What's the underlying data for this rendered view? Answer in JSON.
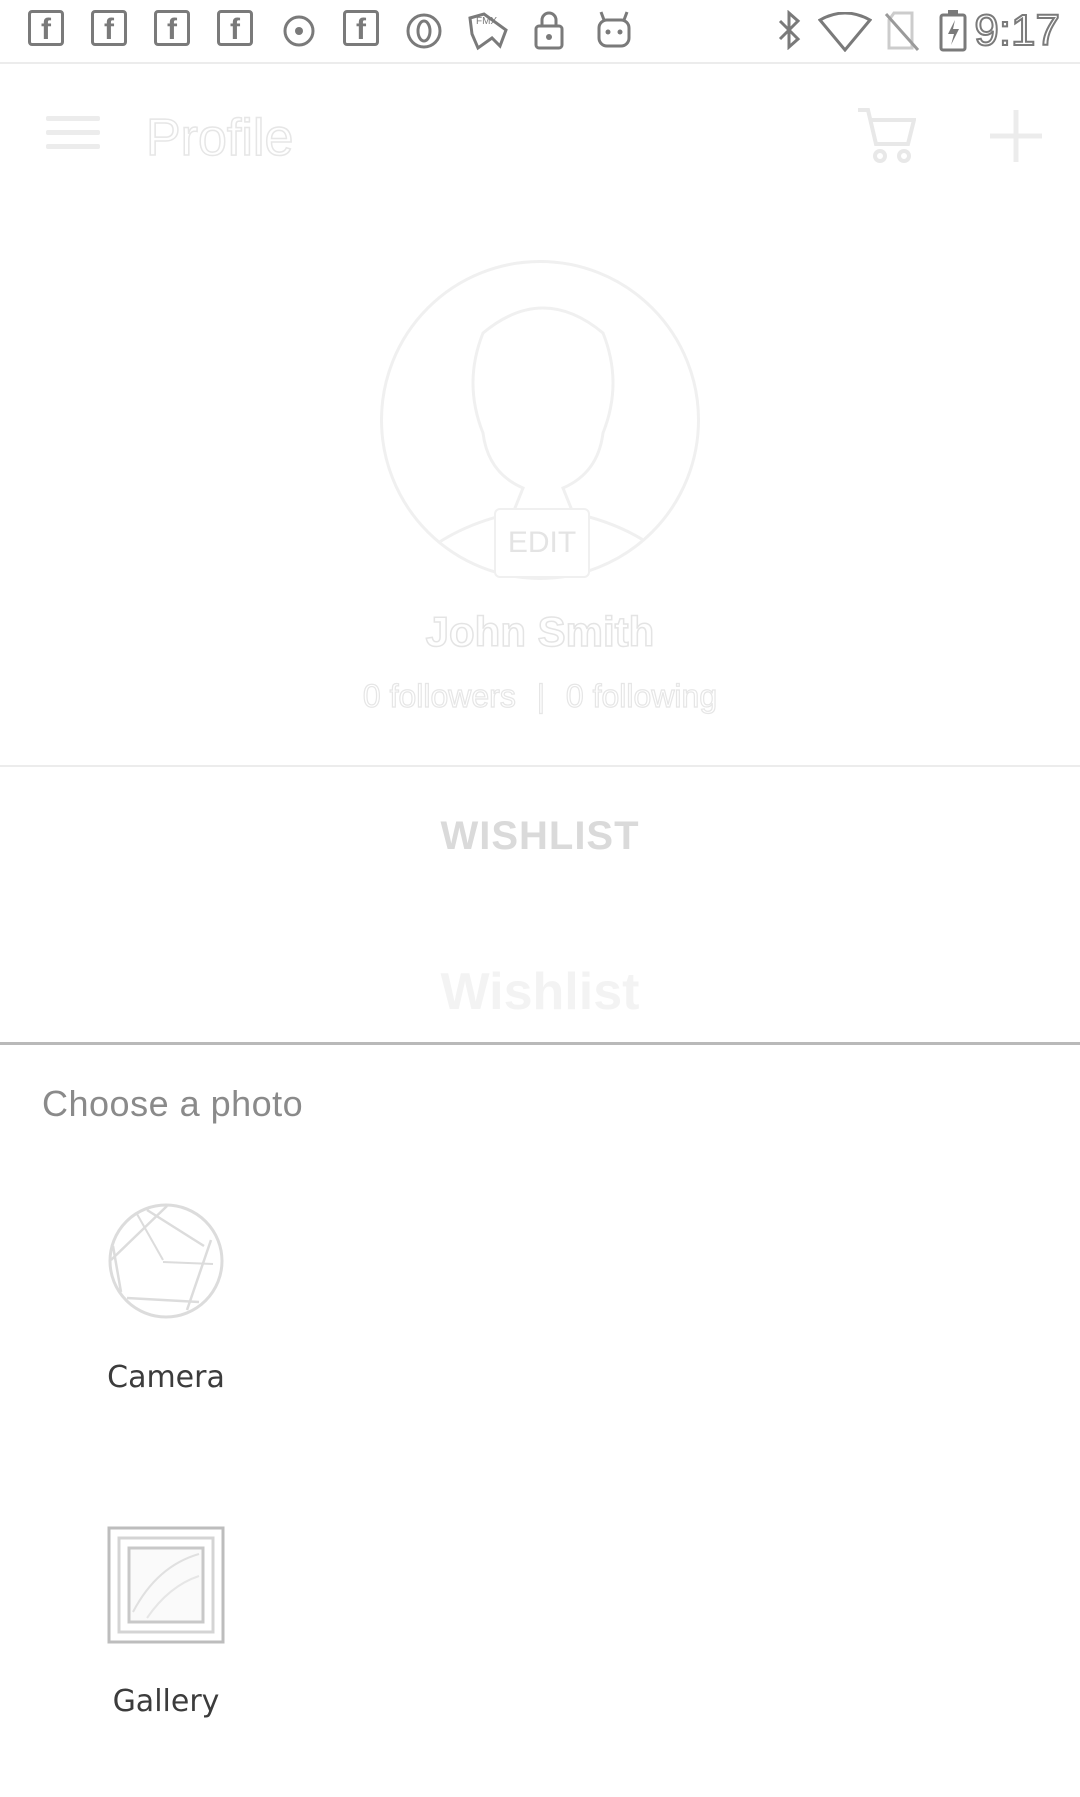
{
  "status_bar": {
    "time": "9:17",
    "notification_icons": [
      "facebook-icon",
      "facebook-icon",
      "facebook-icon",
      "facebook-icon",
      "record-icon",
      "facebook-icon",
      "opera-icon",
      "game-controller-icon",
      "lock-icon",
      "android-icon"
    ],
    "system_icons": [
      "bluetooth-icon",
      "wifi-icon",
      "no-sim-icon",
      "battery-charging-icon"
    ]
  },
  "app_bar": {
    "title": "Profile"
  },
  "profile": {
    "edit_label": "EDIT",
    "name": "John Smith",
    "followers": "0 followers",
    "separator": "|",
    "following": "0 following"
  },
  "tabs": {
    "wishlist_tab": "WISHLIST"
  },
  "wishlist": {
    "heading": "Wishlist"
  },
  "sheet": {
    "title": "Choose a photo",
    "options": [
      {
        "label": "Camera",
        "icon": "camera-aperture-icon"
      },
      {
        "label": "Gallery",
        "icon": "gallery-picture-icon"
      }
    ]
  },
  "colors": {
    "scrim_text": "#e6e6e6",
    "sheet_border": "#b9b9b9",
    "label": "#3c3c3c"
  }
}
